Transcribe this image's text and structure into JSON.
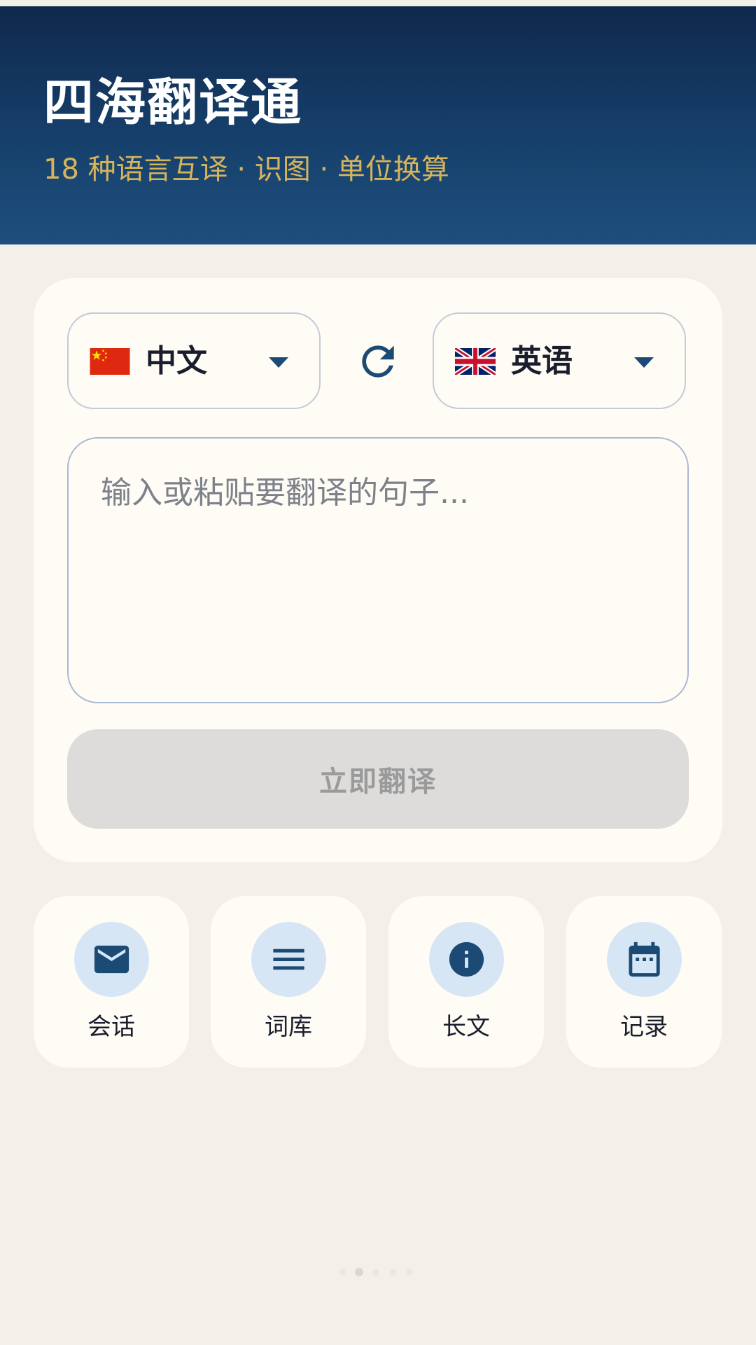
{
  "header": {
    "title": "四海翻译通",
    "subtitle": "18 种语言互译 · 识图 · 单位换算"
  },
  "translator": {
    "source_language": "中文",
    "target_language": "英语",
    "source_flag": "china-flag",
    "target_flag": "uk-flag",
    "swap_icon": "refresh-icon",
    "input_value": "",
    "input_placeholder": "输入或粘贴要翻译的句子...",
    "translate_button": "立即翻译"
  },
  "features": [
    {
      "label": "会话",
      "icon": "mail-icon"
    },
    {
      "label": "词库",
      "icon": "menu-icon"
    },
    {
      "label": "长文",
      "icon": "info-icon"
    },
    {
      "label": "记录",
      "icon": "calendar-icon"
    }
  ],
  "pager": {
    "count": 5,
    "active_index": 1
  },
  "colors": {
    "header_dark": "#10284c",
    "header_light": "#1e4e7e",
    "accent_gold": "#d6b45c",
    "icon_blue": "#1b4a74",
    "icon_bg": "#d7e6f5",
    "background": "#f3f0ea",
    "card": "#fffcf6"
  }
}
